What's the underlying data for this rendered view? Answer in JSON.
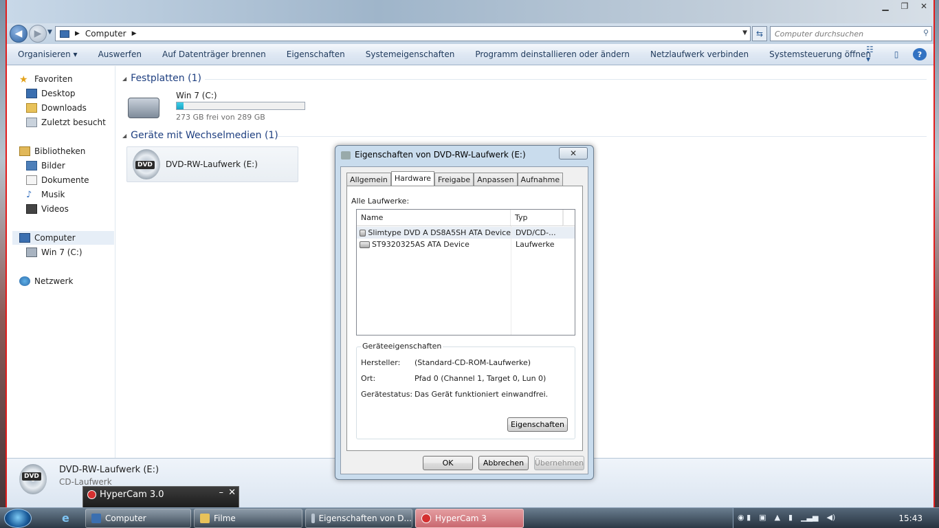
{
  "explorer": {
    "breadcrumb": "Computer",
    "search_placeholder": "Computer durchsuchen",
    "commands": [
      "Organisieren",
      "Auswerfen",
      "Auf Datenträger brennen",
      "Eigenschaften",
      "Systemeigenschaften",
      "Programm deinstallieren oder ändern",
      "Netzlaufwerk verbinden",
      "Systemsteuerung öffnen"
    ],
    "nav": {
      "favorites": "Favoriten",
      "desktop": "Desktop",
      "downloads": "Downloads",
      "recent": "Zuletzt besucht",
      "libraries": "Bibliotheken",
      "pictures": "Bilder",
      "documents": "Dokumente",
      "music": "Musik",
      "videos": "Videos",
      "computer": "Computer",
      "win7": "Win 7 (C:)",
      "network": "Netzwerk"
    },
    "groups": {
      "hard_disks": "Festplatten (1)",
      "removable": "Geräte mit Wechselmedien (1)"
    },
    "drive_c": {
      "name": "Win 7 (C:)",
      "space": "273 GB frei von 289 GB",
      "used_fraction": 0.055
    },
    "drive_e": {
      "name": "DVD-RW-Laufwerk (E:)",
      "badge": "DVD"
    },
    "details": {
      "name": "DVD-RW-Laufwerk (E:)",
      "type": "CD-Laufwerk"
    }
  },
  "dialog": {
    "title": "Eigenschaften von DVD-RW-Laufwerk (E:)",
    "close": "✕",
    "tabs": [
      "Allgemein",
      "Hardware",
      "Freigabe",
      "Anpassen",
      "Aufnahme"
    ],
    "all_drives_label": "Alle Laufwerke:",
    "columns": [
      "Name",
      "Typ"
    ],
    "rows": [
      {
        "name": "Slimtype DVD A  DS8A5SH ATA Device",
        "type": "DVD/CD-..."
      },
      {
        "name": "ST9320325AS ATA Device",
        "type": "Laufwerke"
      }
    ],
    "device_props_label": "Geräteeigenschaften",
    "manufacturer_label": "Hersteller:",
    "manufacturer": "(Standard-CD-ROM-Laufwerke)",
    "location_label": "Ort:",
    "location": "Pfad 0 (Channel 1, Target 0, Lun 0)",
    "status_label": "Gerätestatus:",
    "status": "Das Gerät funktioniert einwandfrei.",
    "properties_button": "Eigenschaften",
    "ok": "OK",
    "cancel": "Abbrechen",
    "apply": "Übernehmen"
  },
  "hypercam": {
    "title": "HyperCam 3.0",
    "minimize": "–",
    "close": "✕"
  },
  "taskbar": {
    "items": [
      "Computer",
      "Filme",
      "Eigenschaften von D...",
      "HyperCam 3"
    ],
    "clock": "15:43"
  }
}
